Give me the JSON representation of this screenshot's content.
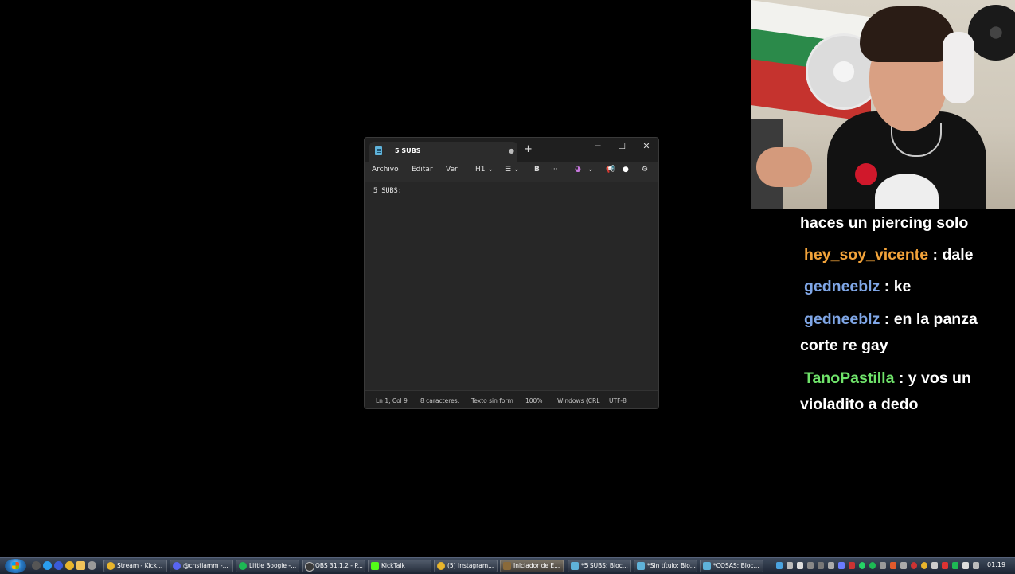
{
  "notepad": {
    "tab_title": "5 SUBS",
    "menus": [
      "Archivo",
      "Editar",
      "Ver"
    ],
    "toolbar": {
      "heading": "H1",
      "bold": "B",
      "more": "···"
    },
    "content": "5 SUBS: ",
    "status": {
      "position": "Ln 1, Col 9",
      "chars": "8 caracteres.",
      "format": "Texto sin form",
      "zoom": "100%",
      "line_ending": "Windows (CRL",
      "encoding": "UTF-8"
    }
  },
  "chat": [
    {
      "user": "",
      "message": "haces un piercing solo",
      "color": "#ffffff"
    },
    {
      "user": "hey_soy_vicente",
      "message": " : dale",
      "color": "#f2a33a"
    },
    {
      "user": "gedneeblz",
      "message": " : ke",
      "color": "#7fa6e6"
    },
    {
      "user": "gedneeblz",
      "message": " : en la panza",
      "color": "#7fa6e6"
    },
    {
      "user": "",
      "message": "corte re gay",
      "color": "#ffffff"
    },
    {
      "user": "TanoPastilla",
      "message": " : y vos un",
      "color": "#6fe36a"
    },
    {
      "user": "",
      "message": "violadito a dedo",
      "color": "#ffffff"
    }
  ],
  "taskbar": {
    "items": [
      {
        "label": "Stream - Kick...",
        "icon_color": "#e8b52c"
      },
      {
        "label": "@cnstiamm -...",
        "icon_color": "#5865f2"
      },
      {
        "label": "Little Boogie -...",
        "icon_color": "#1db954"
      },
      {
        "label": "OBS 31.1.2 - P...",
        "icon_color": "#3a3a3a"
      },
      {
        "label": "KickTalk",
        "icon_color": "#53fc18"
      },
      {
        "label": "(5) Instagram...",
        "icon_color": "#e8b52c"
      },
      {
        "label": "Iniciador de E...",
        "icon_color": "#8a6a3a"
      },
      {
        "label": "*5 SUBS: Bloc...",
        "icon_color": "#5fb2d9"
      },
      {
        "label": "*Sin título: Blo...",
        "icon_color": "#5fb2d9"
      },
      {
        "label": "*COSAS: Bloc...",
        "icon_color": "#5fb2d9"
      }
    ],
    "clock": "01:19"
  }
}
